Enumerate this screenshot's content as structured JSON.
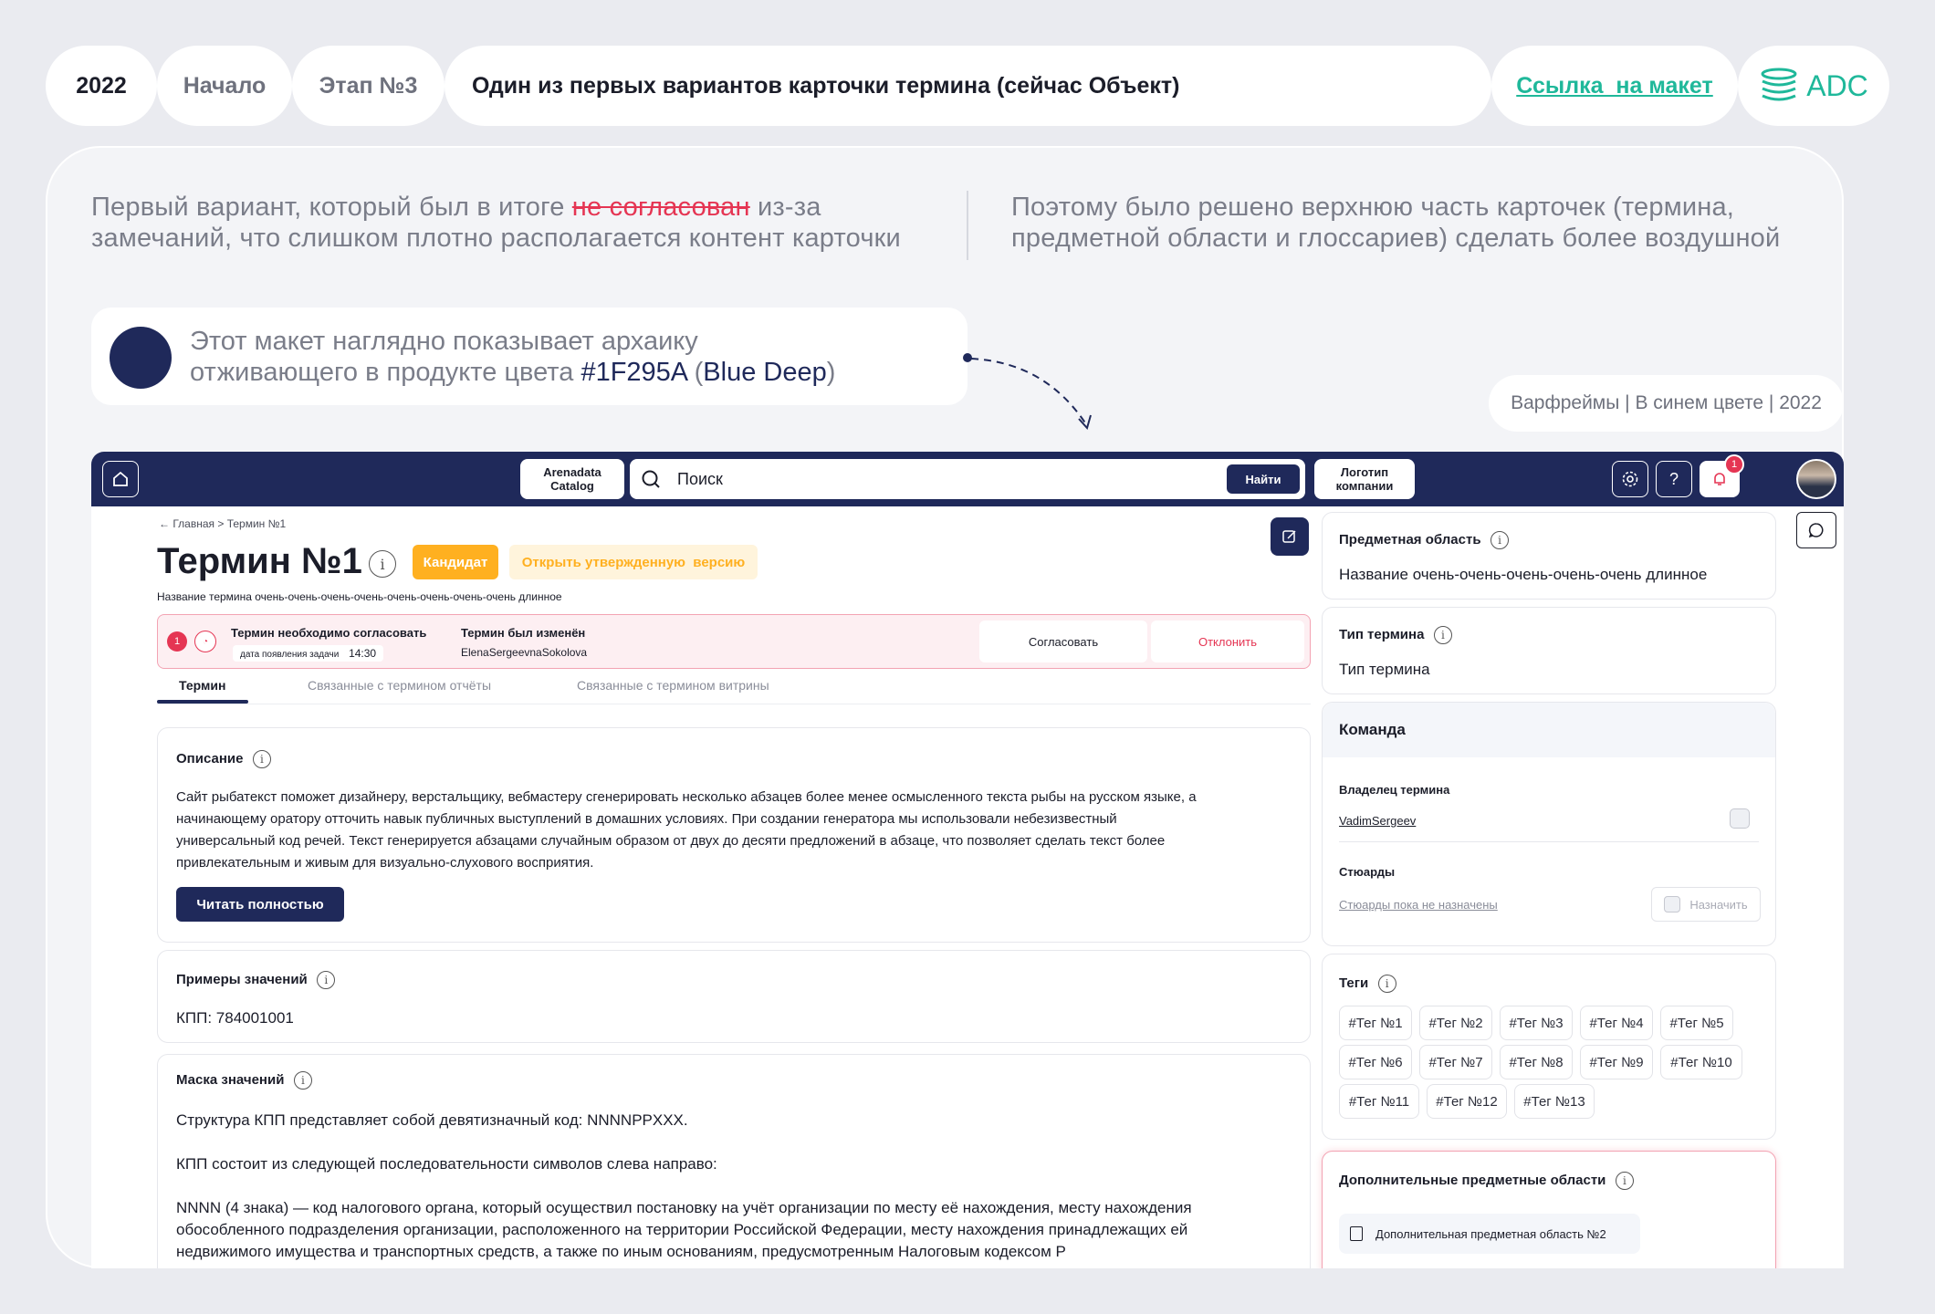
{
  "header": {
    "year": "2022",
    "start": "Начало",
    "stage": "Этап №3",
    "title": "Один из первых вариантов карточки термина (сейчас Объект)",
    "link": "Ссылка  на макет",
    "logo_text": "ADC"
  },
  "intro": {
    "left_1": "Первый вариант, который был в итоге ",
    "left_strike": "не согласован",
    "left_2": " из-за",
    "left_3": "замечаний, что слишком плотно располагается контент карточки",
    "right_1": "Поэтому было решено верхнюю часть карточек (термина,",
    "right_2": "предметной области и глоссариев) сделать более воздушной"
  },
  "note": {
    "line1": "Этот макет наглядно показывает архаику",
    "line2_pre": "отживающего в продукте цвета ",
    "color_code": "#1F295A",
    "paren_open": " (",
    "color_name": "Blue Deep",
    "paren_close": ")",
    "swatch": "#1F295A"
  },
  "wireframe_label": "Варфреймы | В синем цвете | 2022",
  "app": {
    "catalog_btn": "Arenadata Catalog",
    "search_placeholder": "Поиск",
    "find_btn": "Найти",
    "company_logo": "Логотип компании",
    "notif_count": "1",
    "breadcrumb": "Главная > Термин №1",
    "term_title": "Термин №1",
    "badge": "Кандидат",
    "open_version": "Открыть утвержденную  версию",
    "term_subtitle": "Название термина очень-очень-очень-очень-очень-очень-очень-очень длинное",
    "alert": {
      "count": "1",
      "title": "Термин необходимо согласовать",
      "sub_label": "дата появления задачи",
      "time": "14:30",
      "changed_title": "Термин был изменён",
      "changed_by": "ElenaSergeevnaSokolova",
      "approve": "Согласовать",
      "reject": "Отклонить"
    },
    "tabs": [
      "Термин",
      "Связанные с термином отчёты",
      "Связанные с термином витрины"
    ],
    "description": {
      "label": "Описание",
      "p1": "Сайт рыбатекст поможет дизайнеру, верстальщику, вебмастеру сгенерировать несколько абзацев более менее осмысленного текста рыбы на русском языке, а",
      "p2": "начинающему оратору отточить навык публичных выступлений в домашних условиях. При создании генератора мы использовали небезизвестный",
      "p3": "универсальный код речей. Текст генерируется абзацами случайным образом от двух до десяти предложений в абзаце, что позволяет сделать текст более",
      "p4": "привлекательным и живым для визуально-слухового восприятия.",
      "read_more": "Читать полностью"
    },
    "examples": {
      "label": "Примеры значений",
      "value": "КПП: 784001001"
    },
    "mask": {
      "label": "Маска значений",
      "l1": "Структура КПП представляет собой девятизначный код: NNNNPPXXX.",
      "l2": "КПП состоит из следующей последовательности символов слева направо:",
      "l3": "NNNN (4 знака) — код налогового органа, который осуществил постановку на учёт организации по месту её нахождения, месту нахождения",
      "l4": "обособленного подразделения организации, расположенного на территории Российской Федерации, месту нахождения принадлежащих ей",
      "l5": "недвижимого имущества и транспортных средств, а также по иным основаниям, предусмотренным Налоговым кодексом Р"
    },
    "side": {
      "subject_label": "Предметная область",
      "subject_value": "Название очень-очень-очень-очень-очень длинное",
      "type_label": "Тип термина",
      "type_value": "Тип термина",
      "team_label": "Команда",
      "owner_label": "Владелец термина",
      "owner_value": "VadimSergeev",
      "stewards_label": "Стюарды",
      "stewards_value": "Стюарды пока не назначены",
      "assign": "Назначить",
      "tags_label": "Теги",
      "tags": [
        "#Тег №1",
        "#Тег №2",
        "#Тег №3",
        "#Тег №4",
        "#Тег №5",
        "#Тег №6",
        "#Тег №7",
        "#Тег №8",
        "#Тег №9",
        "#Тег №10",
        "#Тег №11",
        "#Тег №12",
        "#Тег №13"
      ],
      "extra_label": "Дополнительные предметные области",
      "extra_item": "Дополнительная предметная область №2"
    }
  },
  "colors": {
    "brand_deep": "#1F295A",
    "accent_green": "#1fb89a",
    "warning": "#ffb020",
    "danger": "#e53553"
  }
}
